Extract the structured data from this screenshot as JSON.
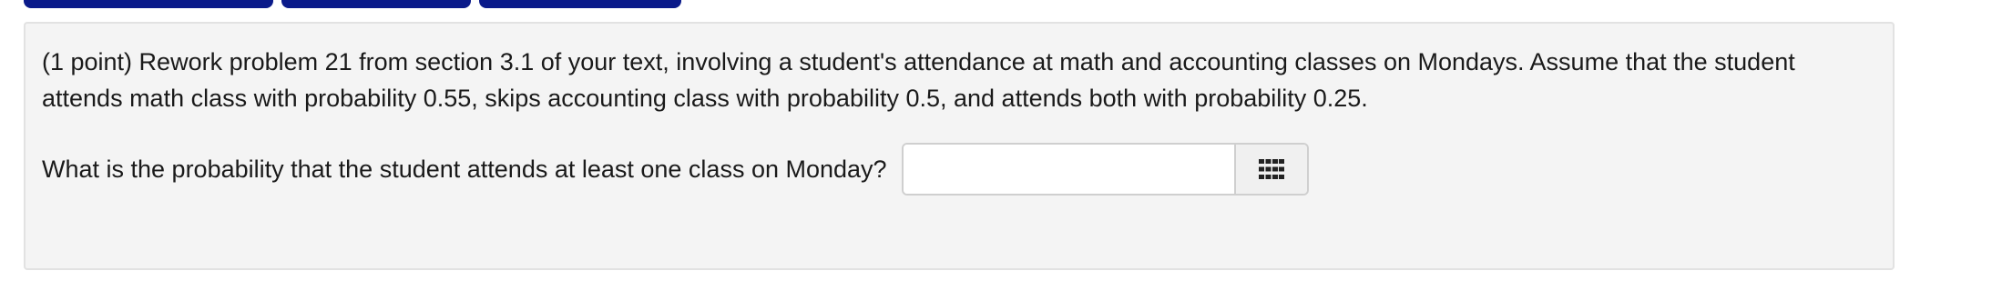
{
  "problem": {
    "statement": "(1 point) Rework problem 21 from section 3.1 of your text, involving a student's attendance at math and accounting classes on Mondays. Assume that the student attends math class with probability 0.55, skips accounting class with probability 0.5, and attends both with probability 0.25.",
    "question": "What is the probability that the student attends at least one class on Monday?"
  },
  "answer": {
    "value": "",
    "placeholder": "",
    "keypad_icon": "keypad-grid-icon"
  },
  "colors": {
    "tab_accent": "#0a1a8a",
    "box_background": "#f4f4f4",
    "box_border": "#e2e2e2",
    "text": "#1a1a1a"
  }
}
